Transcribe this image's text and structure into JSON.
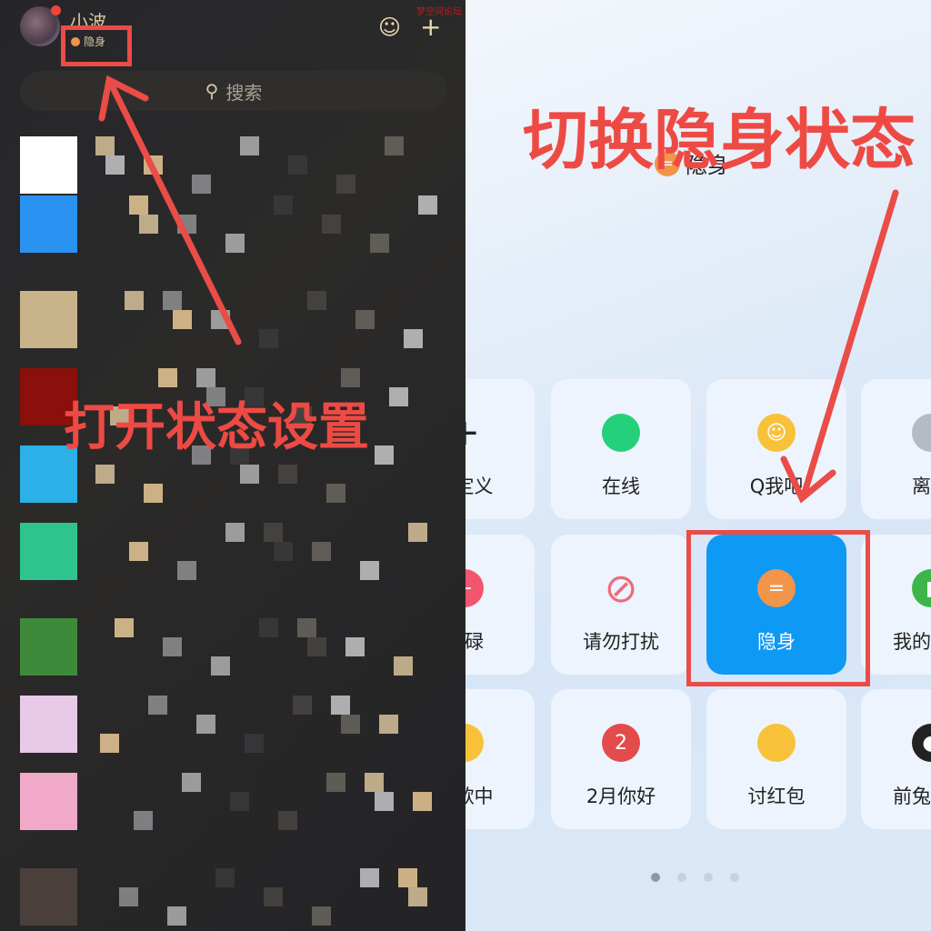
{
  "profile": {
    "name": "小波",
    "status": "隐身",
    "status_color": "#f0954a"
  },
  "top_icons": [
    "pet-icon",
    "plus-icon"
  ],
  "search": {
    "placeholder": "搜索"
  },
  "status_panel": {
    "current": "隐身",
    "grid": [
      {
        "label": "自定义",
        "icon": "plus-icon"
      },
      {
        "label": "在线",
        "icon": "green-dot-icon",
        "color": "#25d07a"
      },
      {
        "label": "Q我吧",
        "icon": "smile-icon",
        "color": "#f7c23a"
      },
      {
        "label": "离开",
        "icon": "gray-dot-icon",
        "color": "#b5bac3"
      },
      {
        "label": "忙碌",
        "icon": "minus-icon",
        "color": "#f2566e"
      },
      {
        "label": "请勿打扰",
        "icon": "no-entry-icon",
        "color": "#ee6a7d"
      },
      {
        "label": "隐身",
        "icon": "equals-icon",
        "color": "#f0954a",
        "selected": true
      },
      {
        "label": "我的电量",
        "icon": "battery-icon",
        "color": "#3cb54a"
      },
      {
        "label": "听歌中",
        "icon": "headphones-emoji-icon",
        "color": "#f7c23a"
      },
      {
        "label": "2月你好",
        "icon": "calendar-icon",
        "color": "#e44b4b"
      },
      {
        "label": "讨红包",
        "icon": "chick-icon",
        "color": "#f7c23a"
      },
      {
        "label": "前兔无量",
        "icon": "penguin-icon",
        "color": "#222222"
      }
    ],
    "page_count": 4,
    "current_page": 1,
    "selected_color": "#0e99f5"
  },
  "annotations": {
    "left": "打开状态设置",
    "right": "切换隐身状态",
    "color": "#ee4a44"
  },
  "watermark": "梦空间论坛"
}
